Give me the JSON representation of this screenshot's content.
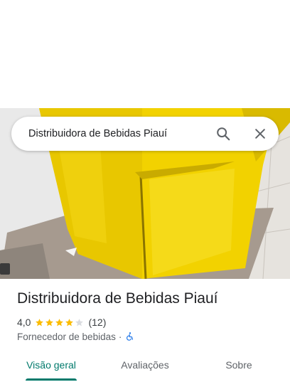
{
  "search": {
    "query": "Distribuidora de Bebidas Piauí"
  },
  "place": {
    "name": "Distribuidora de Bebidas Piauí",
    "rating": "4,0",
    "rating_value": 4.0,
    "rating_max": 5,
    "review_count": "(12)",
    "category": "Fornecedor de bebidas",
    "separator": "·"
  },
  "tabs": [
    {
      "label": "Visão geral",
      "active": true
    },
    {
      "label": "Avaliações",
      "active": false
    },
    {
      "label": "Sobre",
      "active": false
    }
  ],
  "colors": {
    "accent": "#00796b",
    "star": "#fbbc04",
    "star_empty": "#dadce0",
    "accessible_icon": "#1a73e8",
    "fridge_yellow": "#f2d200"
  },
  "icons": {
    "search": "search-icon",
    "close": "close-icon",
    "accessible": "wheelchair-icon",
    "star": "star-icon"
  }
}
